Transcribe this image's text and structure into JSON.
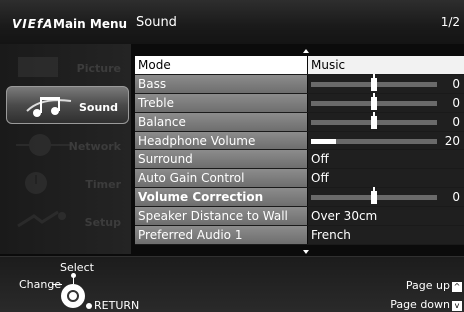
{
  "header": {
    "brand": "VIEfA",
    "menu_title": "Main Menu",
    "section_title": "Sound",
    "page_indicator": "1/2"
  },
  "sidebar": {
    "items": [
      {
        "label": "Picture",
        "icon": "picture-icon",
        "active": false
      },
      {
        "label": "Sound",
        "icon": "music-notes-icon",
        "active": true
      },
      {
        "label": "Network",
        "icon": "network-globe-icon",
        "active": false
      },
      {
        "label": "Timer",
        "icon": "clock-icon",
        "active": false
      },
      {
        "label": "Setup",
        "icon": "setup-icon",
        "active": false
      }
    ]
  },
  "settings": {
    "rows": [
      {
        "label": "Mode",
        "value": "Music",
        "type": "text",
        "selected": true
      },
      {
        "label": "Bass",
        "value": "0",
        "type": "slider-center",
        "level": 0.5
      },
      {
        "label": "Treble",
        "value": "0",
        "type": "slider-center",
        "level": 0.5
      },
      {
        "label": "Balance",
        "value": "0",
        "type": "slider-center",
        "level": 0.5
      },
      {
        "label": "Headphone Volume",
        "value": "20",
        "type": "slider-fill",
        "level": 0.2
      },
      {
        "label": "Surround",
        "value": "Off",
        "type": "text"
      },
      {
        "label": "Auto Gain Control",
        "value": "Off",
        "type": "text"
      },
      {
        "label": "Volume Correction",
        "value": "0",
        "type": "slider-center",
        "level": 0.5,
        "bold": true
      },
      {
        "label": "Speaker Distance to Wall",
        "value": "Over 30cm",
        "type": "text"
      },
      {
        "label": "Preferred Audio 1",
        "value": "French",
        "type": "text"
      }
    ]
  },
  "footer": {
    "select": "Select",
    "change": "Change",
    "return": "RETURN",
    "page_up": "Page up",
    "page_down": "Page down"
  },
  "colors": {
    "selected_row": "#ffffff",
    "label_bg": "#7d7d7d",
    "value_bg": "#1f1f1f"
  }
}
